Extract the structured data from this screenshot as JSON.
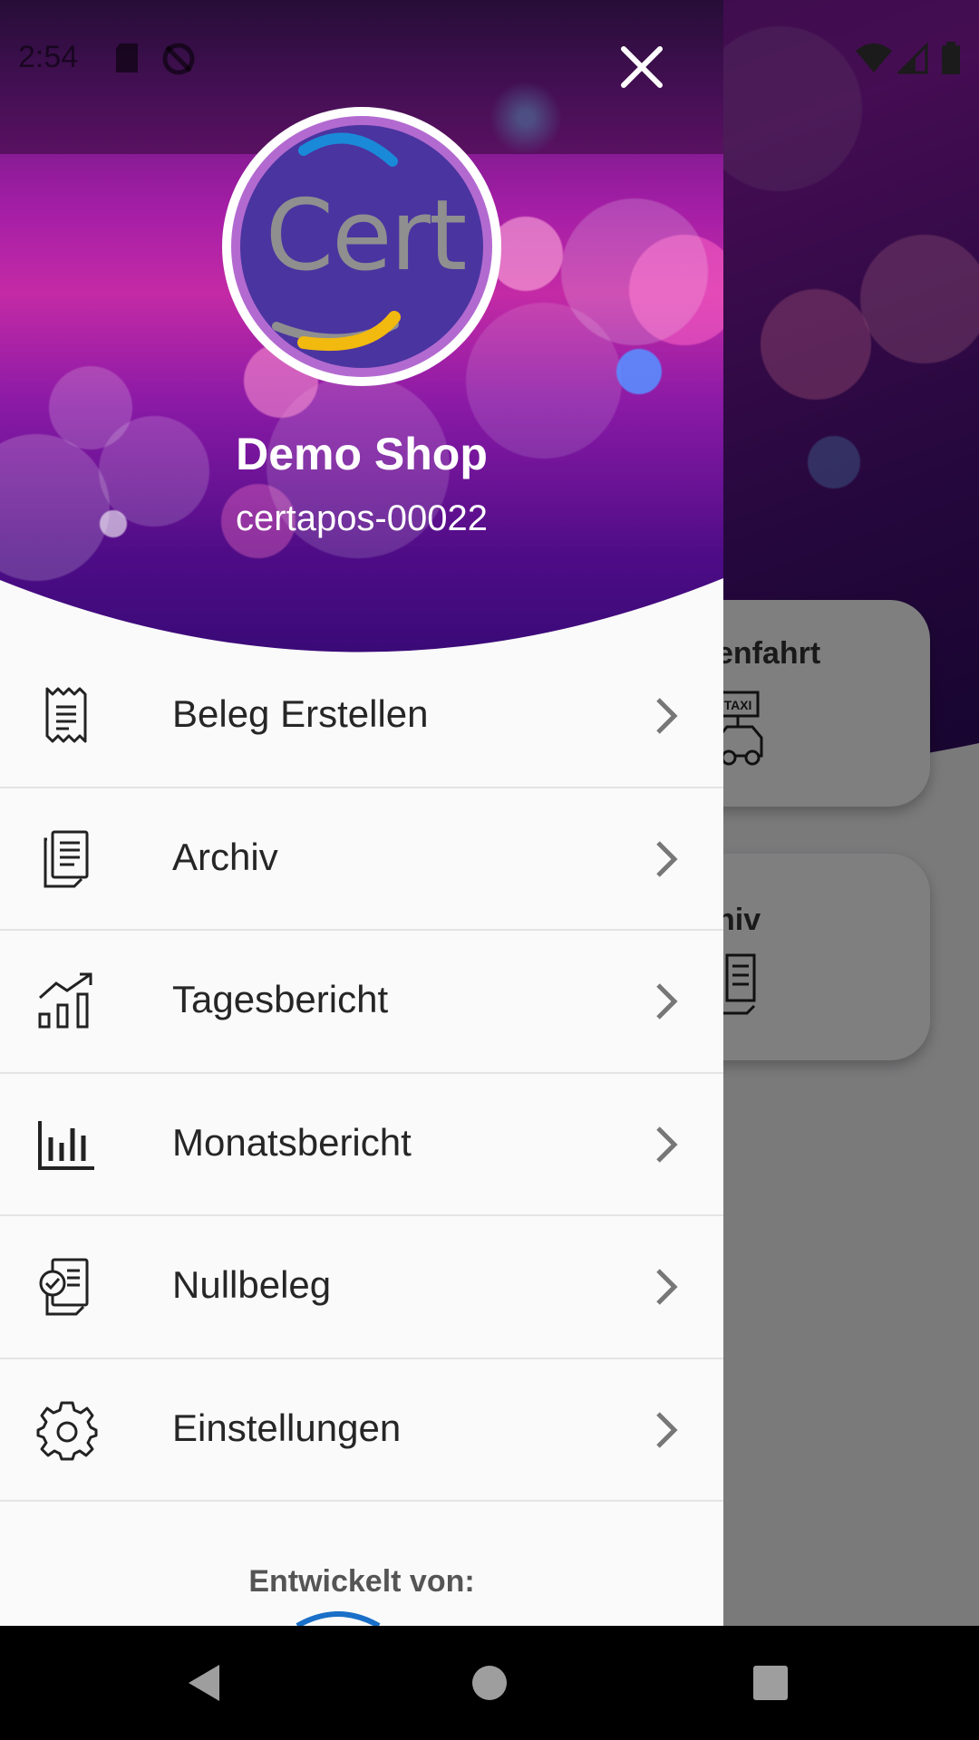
{
  "status_bar": {
    "time": "2:54",
    "icons": [
      "sd-card-icon",
      "sync-disabled-icon",
      "wifi-icon",
      "signal-icon",
      "battery-icon"
    ]
  },
  "drawer": {
    "close_icon": "close-icon",
    "header": {
      "logo_text": "Cert",
      "shop_name": "Demo Shop",
      "device_id": "certapos-00022",
      "gradient_colors": [
        "#6a1882",
        "#c42aa5",
        "#4e0c86"
      ]
    },
    "menu": [
      {
        "label": "Beleg Erstellen",
        "icon": "receipt-icon"
      },
      {
        "label": "Archiv",
        "icon": "documents-icon"
      },
      {
        "label": "Tagesbericht",
        "icon": "trending-chart-icon"
      },
      {
        "label": "Monatsbericht",
        "icon": "bar-chart-icon"
      },
      {
        "label": "Nullbeleg",
        "icon": "checked-document-icon"
      },
      {
        "label": "Einstellungen",
        "icon": "gear-icon"
      }
    ],
    "footer": {
      "developed_by": "Entwickelt von:"
    }
  },
  "background_app": {
    "cards": [
      {
        "label": "enfahrt",
        "icon": "taxi-icon"
      },
      {
        "label": "hiv",
        "icon": "documents-icon"
      }
    ]
  },
  "nav_bar": {
    "buttons": [
      "back-icon",
      "home-icon",
      "recents-icon"
    ]
  },
  "colors": {
    "menu_text": "#262626",
    "divider": "#e4e4e4",
    "drawer_bg": "#fafafa"
  }
}
